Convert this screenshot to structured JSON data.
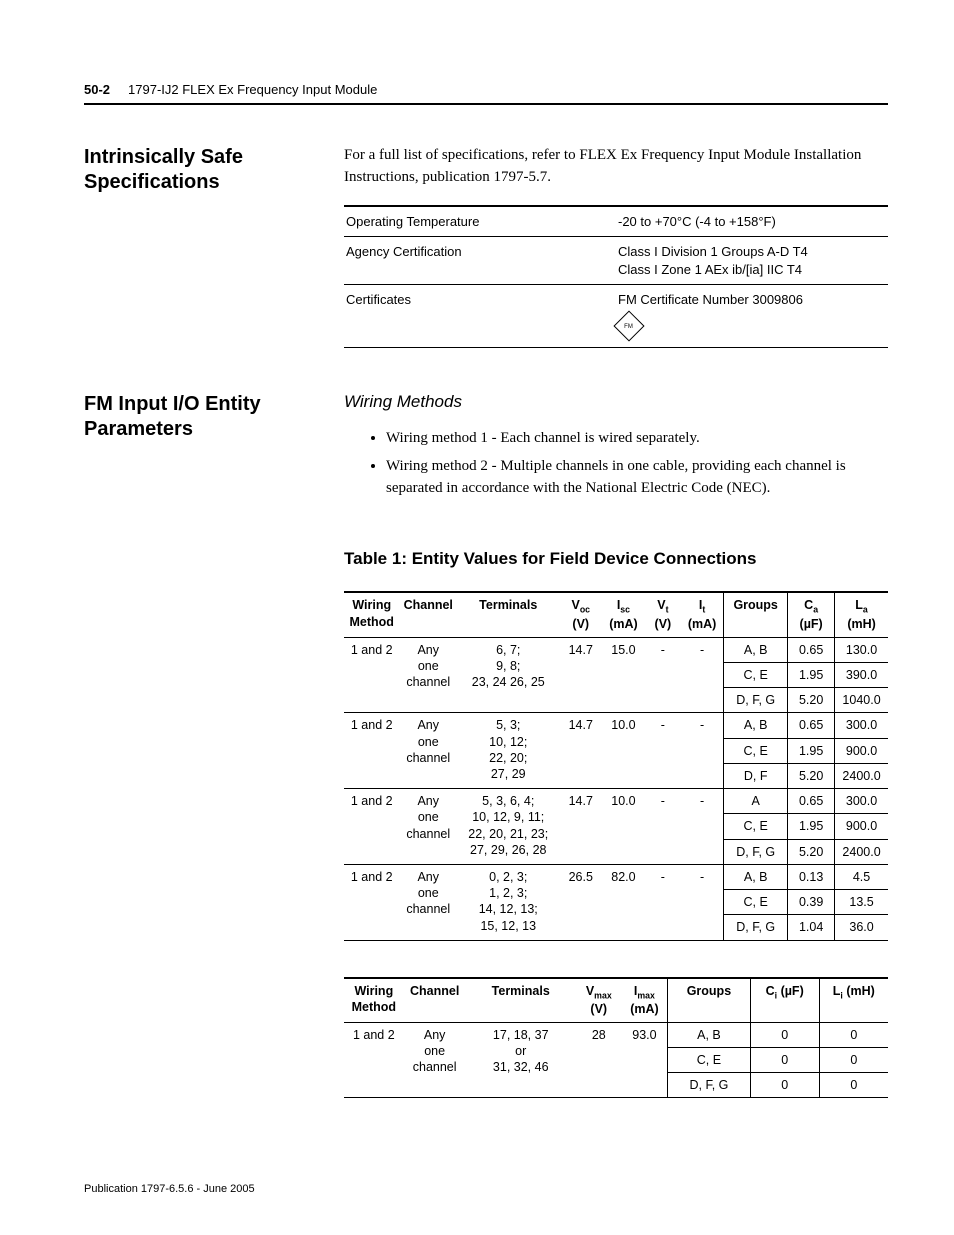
{
  "header": {
    "page": "50-2",
    "doc": "1797-IJ2 FLEX Ex Frequency Input Module"
  },
  "footer": {
    "pub": "Publication 1797-6.5.6 - June 2005"
  },
  "sec1": {
    "title": "Intrinsically Safe Specifications",
    "lead": "For a full list of specifications, refer to FLEX Ex Frequency Input Module Installation Instructions, publication 1797-5.7.",
    "rows": [
      {
        "k": "Operating Temperature",
        "v": "-20 to +70°C (-4 to +158°F)"
      },
      {
        "k": "Agency Certification",
        "v": "Class I Division 1 Groups A-D T4\nClass I Zone 1 AEx ib/[ia] IIC T4"
      },
      {
        "k": "Certificates",
        "v": "FM Certificate Number 3009806"
      }
    ]
  },
  "sec2": {
    "title": "FM Input I/O Entity Parameters",
    "subhead": "Wiring Methods",
    "bullets": [
      "Wiring method 1 - Each channel is wired separately.",
      "Wiring method 2 - Multiple channels in one cable, providing each channel is separated in accordance with the National Electric Code (NEC)."
    ],
    "table1_title": "Table 1: Entity Values for Field Device Connections"
  },
  "chart_data": [
    {
      "type": "table",
      "title": "Entity Values for Field Device Connections (Output)",
      "columns": [
        "Wiring Method",
        "Channel",
        "Terminals",
        "Voc (V)",
        "Isc (mA)",
        "Vt (V)",
        "It (mA)",
        "Groups",
        "Ca (µF)",
        "La (mH)"
      ],
      "rows": [
        [
          "1 and 2",
          "Any one channel",
          "6, 7; 9, 8; 23, 24 26, 25",
          "14.7",
          "15.0",
          "-",
          "-",
          "A, B",
          "0.65",
          "130.0"
        ],
        [
          "",
          "",
          "",
          "",
          "",
          "",
          "",
          "C, E",
          "1.95",
          "390.0"
        ],
        [
          "",
          "",
          "",
          "",
          "",
          "",
          "",
          "D, F, G",
          "5.20",
          "1040.0"
        ],
        [
          "1 and 2",
          "Any one channel",
          "5, 3; 10, 12; 22, 20; 27, 29",
          "14.7",
          "10.0",
          "-",
          "-",
          "A, B",
          "0.65",
          "300.0"
        ],
        [
          "",
          "",
          "",
          "",
          "",
          "",
          "",
          "C, E",
          "1.95",
          "900.0"
        ],
        [
          "",
          "",
          "",
          "",
          "",
          "",
          "",
          "D, F",
          "5.20",
          "2400.0"
        ],
        [
          "1 and 2",
          "Any one channel",
          "5, 3, 6, 4; 10, 12, 9, 11; 22, 20, 21, 23; 27, 29, 26, 28",
          "14.7",
          "10.0",
          "-",
          "-",
          "A",
          "0.65",
          "300.0"
        ],
        [
          "",
          "",
          "",
          "",
          "",
          "",
          "",
          "C, E",
          "1.95",
          "900.0"
        ],
        [
          "",
          "",
          "",
          "",
          "",
          "",
          "",
          "D, F, G",
          "5.20",
          "2400.0"
        ],
        [
          "1 and 2",
          "Any one channel",
          "0, 2, 3; 1, 2, 3; 14, 12, 13; 15, 12, 13",
          "26.5",
          "82.0",
          "-",
          "-",
          "A, B",
          "0.13",
          "4.5"
        ],
        [
          "",
          "",
          "",
          "",
          "",
          "",
          "",
          "C, E",
          "0.39",
          "13.5"
        ],
        [
          "",
          "",
          "",
          "",
          "",
          "",
          "",
          "D, F, G",
          "1.04",
          "36.0"
        ]
      ]
    },
    {
      "type": "table",
      "title": "Entity Values (Input)",
      "columns": [
        "Wiring Method",
        "Channel",
        "Terminals",
        "Vmax (V)",
        "Imax (mA)",
        "Groups",
        "Ci (µF)",
        "Li (mH)"
      ],
      "rows": [
        [
          "1 and 2",
          "Any one channel",
          "17, 18, 37 or 31, 32, 46",
          "28",
          "93.0",
          "A, B",
          "0",
          "0"
        ],
        [
          "",
          "",
          "",
          "",
          "",
          "C, E",
          "0",
          "0"
        ],
        [
          "",
          "",
          "",
          "",
          "",
          "D, F, G",
          "0",
          "0"
        ]
      ]
    }
  ]
}
